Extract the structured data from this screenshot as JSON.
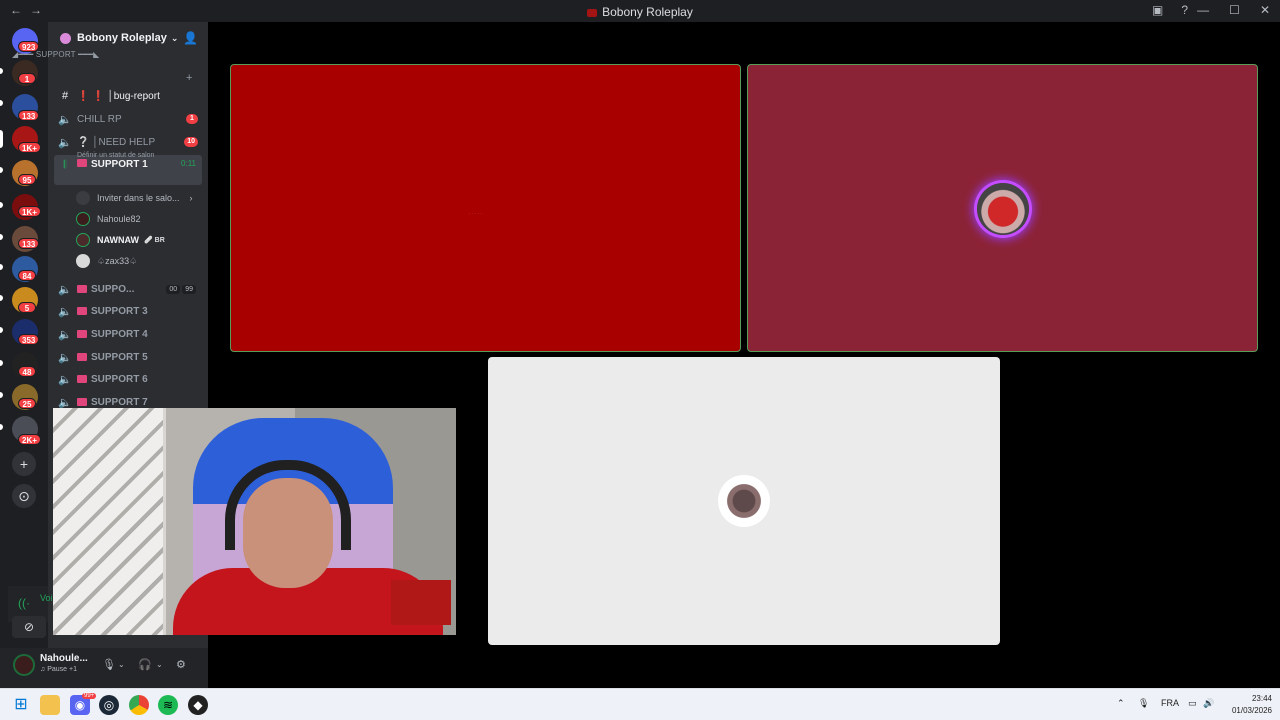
{
  "window": {
    "title": "Bobony Roleplay"
  },
  "rail": {
    "badges": [
      "923",
      "1",
      "133",
      "1K+",
      "95",
      "1K+",
      "133",
      "84",
      "5",
      "353",
      "48",
      "25",
      "2K+"
    ],
    "add_server": "+",
    "explore": "⊙"
  },
  "guild": {
    "name": "Bobony Roleplay"
  },
  "category": {
    "label": "◢━━━ SUPPORT ━━━◣"
  },
  "channels": {
    "bug_report": "❗ ❗ │bug-report",
    "chill_rp": "CHILL RP",
    "chill_rp_ping": "1",
    "need_help": "❔ │NEED HELP",
    "need_help_ping": "10",
    "support1": "SUPPORT 1",
    "support1_timer": "0:11",
    "support1_status": "Définir un statut de salon",
    "invite": "Inviter dans le salo...",
    "support2": "SUPPO...",
    "support2_count_a": "00",
    "support2_count_b": "99",
    "support3": "SUPPORT 3",
    "support4": "SUPPORT 4",
    "support5": "SUPPORT 5",
    "support6": "SUPPORT 6",
    "support7": "SUPPORT 7"
  },
  "voice_users": [
    {
      "name": "Nahoule82"
    },
    {
      "name": "NAWNAW",
      "tag": "🩹 BR"
    },
    {
      "name": "♤zax33♤"
    }
  ],
  "voice_status": {
    "label": "Voi"
  },
  "user_panel": {
    "name": "Nahoule...",
    "status": "♫ Pause +1"
  },
  "taskbar": {
    "lang": "FRA",
    "time": "23:44",
    "date": "01/03/2026",
    "discord_badge": "99+"
  },
  "colors": {
    "tile1": "#a80000",
    "tile2": "#8b2336",
    "tile3": "#ebebeb",
    "speaking": "#5a9b5a",
    "ping": "#f23f43",
    "online": "#23a55a"
  }
}
